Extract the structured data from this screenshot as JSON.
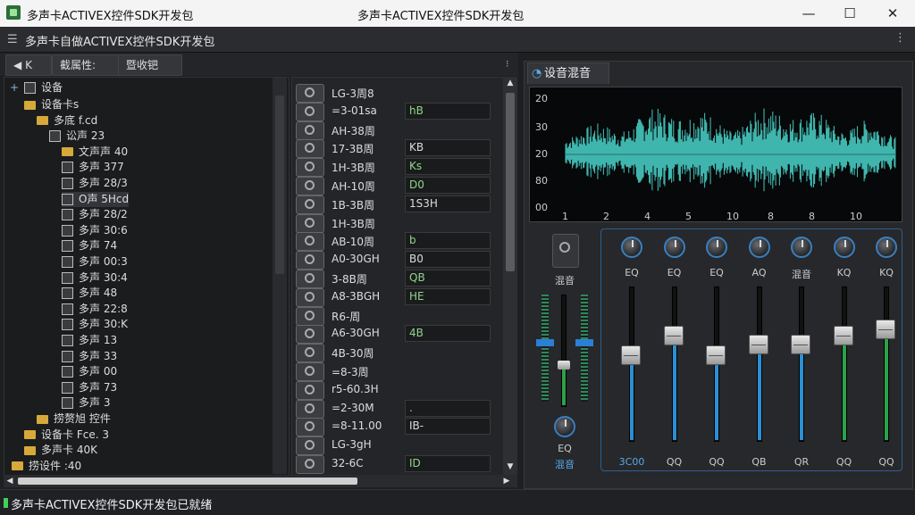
{
  "window": {
    "title": "多声卡ACTIVEX控件SDK开发包",
    "app_title": "多声卡ACTIVEX控件SDK开发包",
    "min_glyph": "—",
    "max_glyph": "☐",
    "close_glyph": "✕"
  },
  "menubar": {
    "title": "多声卡自做ACTIVEX控件SDK开发包"
  },
  "toolbar": {
    "back_label": "K",
    "attr_tab": "截属性:",
    "recv_tab": "暨收钯"
  },
  "tree": {
    "root": "设备",
    "items": [
      {
        "label": "设备卡s",
        "kind": "folder"
      },
      {
        "label": "多底 f.cd",
        "kind": "folder"
      },
      {
        "label": "讼声 23",
        "kind": "device"
      },
      {
        "label": "文声声 40",
        "kind": "folder"
      },
      {
        "label": "多声 377",
        "kind": "device"
      },
      {
        "label": "多声 28/3",
        "kind": "device"
      },
      {
        "label": "O声 5Hcd",
        "kind": "device"
      },
      {
        "label": "多声 28/2",
        "kind": "device"
      },
      {
        "label": "多声 30:6",
        "kind": "device"
      },
      {
        "label": "多声 74",
        "kind": "device"
      },
      {
        "label": "多声 00:3",
        "kind": "device"
      },
      {
        "label": "多声 30:4",
        "kind": "device"
      },
      {
        "label": "多声 48",
        "kind": "device"
      },
      {
        "label": "多声 22:8",
        "kind": "device"
      },
      {
        "label": "多声 30:K",
        "kind": "device"
      },
      {
        "label": "多声 13",
        "kind": "device"
      },
      {
        "label": "多声 33",
        "kind": "device"
      },
      {
        "label": "多声 00",
        "kind": "device"
      },
      {
        "label": "多声 73",
        "kind": "device"
      },
      {
        "label": "多声 3",
        "kind": "device"
      },
      {
        "label": "捞赘旭 控件",
        "kind": "folder"
      },
      {
        "label": "设备卡 Fce. 3",
        "kind": "folder"
      },
      {
        "label": "多声卡 40K",
        "kind": "folder"
      },
      {
        "label": "捞设件 :40",
        "kind": "folder"
      }
    ]
  },
  "list": {
    "rows": [
      {
        "name": "LG-3周8",
        "value": ""
      },
      {
        "name": "=3-01sa",
        "value": "hB"
      },
      {
        "name": "AH-38周",
        "value": ""
      },
      {
        "name": "17-3B周",
        "value": "KB"
      },
      {
        "name": "1H-3B周",
        "value": "Ks"
      },
      {
        "name": "AH-10周",
        "value": "D0"
      },
      {
        "name": "1B-3B周",
        "value": "1S3H"
      },
      {
        "name": "1H-3B周",
        "value": ""
      },
      {
        "name": "AB-10周",
        "value": "b"
      },
      {
        "name": "A0-30GH",
        "value": "B0"
      },
      {
        "name": "3-8B周",
        "value": "QB"
      },
      {
        "name": "A8-3BGH",
        "value": "HE"
      },
      {
        "name": "R6-周",
        "value": ""
      },
      {
        "name": "A6-30GH",
        "value": "4B"
      },
      {
        "name": "4B-30周",
        "value": ""
      },
      {
        "name": "=8-3周",
        "value": ""
      },
      {
        "name": "r5-60.3H",
        "value": ""
      },
      {
        "name": "=2-30M",
        "value": "."
      },
      {
        "name": "=8-11.00",
        "value": "IB-"
      },
      {
        "name": "LG-3gH",
        "value": ""
      },
      {
        "name": "32-6C",
        "value": "ID"
      }
    ]
  },
  "right_panel": {
    "tab_label": "设音混音",
    "chart_data": {
      "type": "area",
      "ylabels": [
        "20",
        "30",
        "20",
        "80",
        "00"
      ],
      "xlabels": [
        "1",
        "2",
        "4",
        "5",
        "10",
        "8",
        "8",
        "10"
      ],
      "color": "#3fb5ad"
    }
  },
  "mixer": {
    "master_label": "混音",
    "master_bottom_label": "EQ",
    "master_bottom_label2": "混音",
    "channels": [
      {
        "top_label": "EQ",
        "bottom_label": "3C00",
        "level": 0.55
      },
      {
        "top_label": "EQ",
        "bottom_label": "QQ",
        "level": 0.68
      },
      {
        "top_label": "EQ",
        "bottom_label": "QQ",
        "level": 0.55
      },
      {
        "top_label": "AQ",
        "bottom_label": "QB",
        "level": 0.62
      },
      {
        "top_label": "混音",
        "bottom_label": "QR",
        "level": 0.62
      },
      {
        "top_label": "KQ",
        "bottom_label": "QQ",
        "level": 0.68
      },
      {
        "top_label": "KQ",
        "bottom_label": "QQ",
        "level": 0.72
      }
    ]
  },
  "status": {
    "text": "多声卡ACTIVEX控件SDK开发包已就绪"
  }
}
